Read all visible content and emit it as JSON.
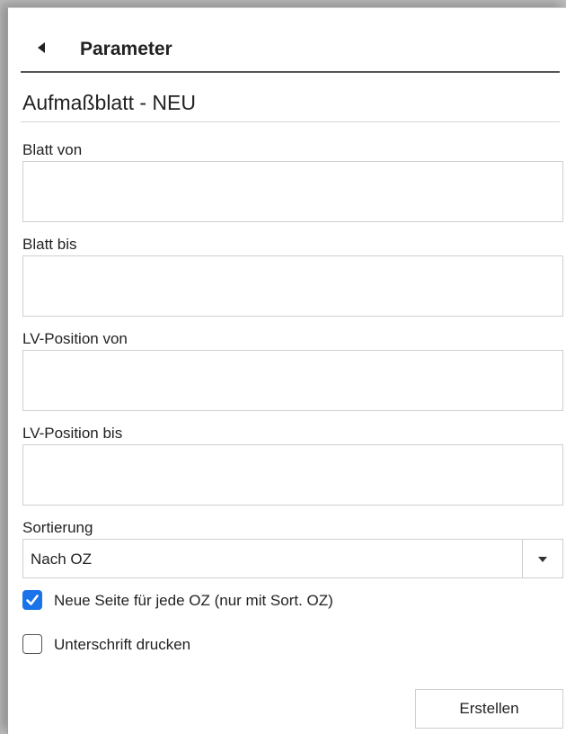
{
  "header": {
    "title": "Parameter",
    "back_icon": "chevron-left-icon"
  },
  "form": {
    "title": "Aufmaßblatt - NEU",
    "fields": [
      {
        "label": "Blatt von",
        "value": ""
      },
      {
        "label": "Blatt bis",
        "value": ""
      },
      {
        "label": "LV-Position von",
        "value": ""
      },
      {
        "label": "LV-Position bis",
        "value": ""
      }
    ],
    "sort": {
      "label": "Sortierung",
      "selected": "Nach OZ",
      "arrow_icon": "caret-down-icon"
    },
    "checkboxes": [
      {
        "label": "Neue Seite für jede OZ (nur mit Sort. OZ)",
        "checked": true
      },
      {
        "label": "Unterschrift drucken",
        "checked": false
      }
    ],
    "submit_label": "Erstellen"
  },
  "colors": {
    "accent": "#1a73e8",
    "text": "#222222",
    "border": "#cfcfcf"
  }
}
